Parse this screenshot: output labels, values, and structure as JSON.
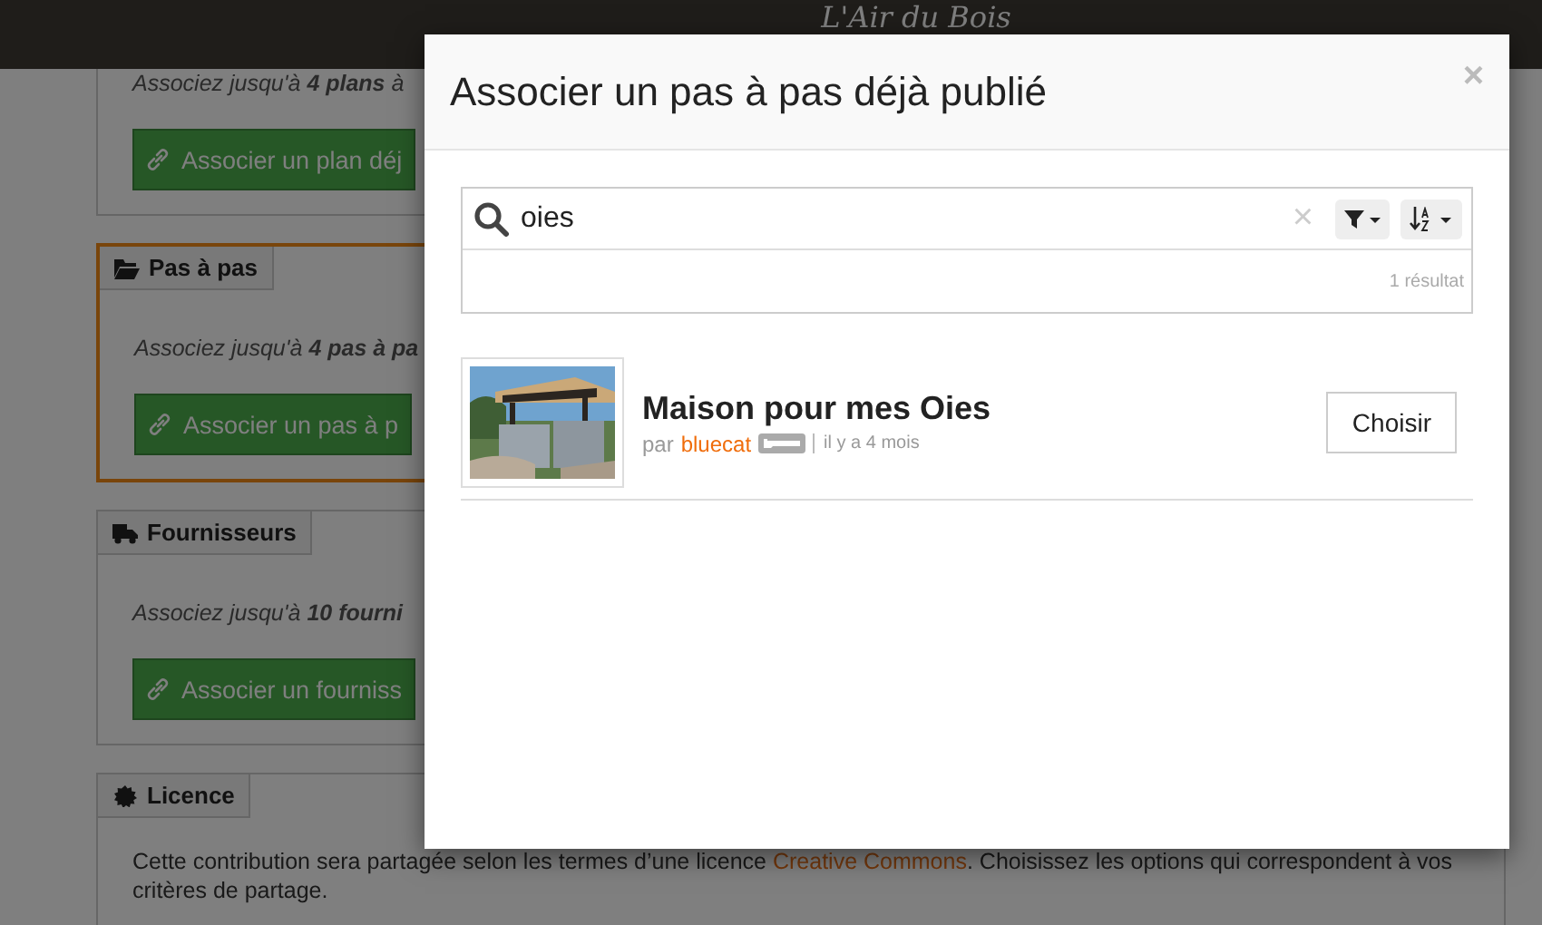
{
  "header": {
    "logo": "L'Air du Bois"
  },
  "panels": [
    {
      "kind": "plans",
      "highlighted": false,
      "description": "Associez jusqu'à **4 plans** à",
      "button": "Associer un plan déj"
    },
    {
      "kind": "steps",
      "highlighted": true,
      "legend": "Pas à pas",
      "description": "Associez jusqu'à **4 pas à pa**",
      "button": "Associer un pas à p"
    },
    {
      "kind": "suppliers",
      "highlighted": false,
      "legend": "Fournisseurs",
      "description": "Associez jusqu'à **10 fourni**",
      "button": "Associer un fourniss"
    },
    {
      "kind": "licence",
      "highlighted": false,
      "legend": "Licence",
      "text_before": "Cette contribution sera partagée selon les termes d’une licence ",
      "link": "Creative Commons",
      "text_after": ". Choisissez les options qui correspondent à vos critères de partage."
    }
  ],
  "modal": {
    "title": "Associer un pas à pas déjà publié",
    "close": "×",
    "search": {
      "value": "oies",
      "clear": "×"
    },
    "result_count": "1 résultat",
    "results": [
      {
        "kind": "picture",
        "title": "Maison pour mes Oies",
        "by": "par",
        "author": "bluecat",
        "time": "il y a 4 mois",
        "button": "Choisir"
      }
    ]
  }
}
